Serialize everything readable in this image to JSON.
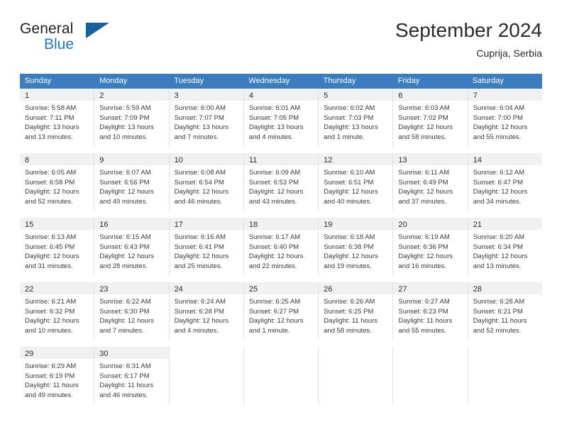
{
  "brand": {
    "name_top": "General",
    "name_bottom": "Blue",
    "flag_color": "#15619e",
    "blue_color": "#2077c4"
  },
  "header": {
    "title": "September 2024",
    "location": "Cuprija, Serbia"
  },
  "theme": {
    "header_blue": "#3b7dbf",
    "daynum_band": "#f1f1f1",
    "cell_border": "#e2e2e2"
  },
  "weekdays": [
    "Sunday",
    "Monday",
    "Tuesday",
    "Wednesday",
    "Thursday",
    "Friday",
    "Saturday"
  ],
  "weeks": [
    [
      {
        "day": "1",
        "sunrise": "Sunrise: 5:58 AM",
        "sunset": "Sunset: 7:11 PM",
        "daylight1": "Daylight: 13 hours",
        "daylight2": "and 13 minutes."
      },
      {
        "day": "2",
        "sunrise": "Sunrise: 5:59 AM",
        "sunset": "Sunset: 7:09 PM",
        "daylight1": "Daylight: 13 hours",
        "daylight2": "and 10 minutes."
      },
      {
        "day": "3",
        "sunrise": "Sunrise: 6:00 AM",
        "sunset": "Sunset: 7:07 PM",
        "daylight1": "Daylight: 13 hours",
        "daylight2": "and 7 minutes."
      },
      {
        "day": "4",
        "sunrise": "Sunrise: 6:01 AM",
        "sunset": "Sunset: 7:05 PM",
        "daylight1": "Daylight: 13 hours",
        "daylight2": "and 4 minutes."
      },
      {
        "day": "5",
        "sunrise": "Sunrise: 6:02 AM",
        "sunset": "Sunset: 7:03 PM",
        "daylight1": "Daylight: 13 hours",
        "daylight2": "and 1 minute."
      },
      {
        "day": "6",
        "sunrise": "Sunrise: 6:03 AM",
        "sunset": "Sunset: 7:02 PM",
        "daylight1": "Daylight: 12 hours",
        "daylight2": "and 58 minutes."
      },
      {
        "day": "7",
        "sunrise": "Sunrise: 6:04 AM",
        "sunset": "Sunset: 7:00 PM",
        "daylight1": "Daylight: 12 hours",
        "daylight2": "and 55 minutes."
      }
    ],
    [
      {
        "day": "8",
        "sunrise": "Sunrise: 6:05 AM",
        "sunset": "Sunset: 6:58 PM",
        "daylight1": "Daylight: 12 hours",
        "daylight2": "and 52 minutes."
      },
      {
        "day": "9",
        "sunrise": "Sunrise: 6:07 AM",
        "sunset": "Sunset: 6:56 PM",
        "daylight1": "Daylight: 12 hours",
        "daylight2": "and 49 minutes."
      },
      {
        "day": "10",
        "sunrise": "Sunrise: 6:08 AM",
        "sunset": "Sunset: 6:54 PM",
        "daylight1": "Daylight: 12 hours",
        "daylight2": "and 46 minutes."
      },
      {
        "day": "11",
        "sunrise": "Sunrise: 6:09 AM",
        "sunset": "Sunset: 6:53 PM",
        "daylight1": "Daylight: 12 hours",
        "daylight2": "and 43 minutes."
      },
      {
        "day": "12",
        "sunrise": "Sunrise: 6:10 AM",
        "sunset": "Sunset: 6:51 PM",
        "daylight1": "Daylight: 12 hours",
        "daylight2": "and 40 minutes."
      },
      {
        "day": "13",
        "sunrise": "Sunrise: 6:11 AM",
        "sunset": "Sunset: 6:49 PM",
        "daylight1": "Daylight: 12 hours",
        "daylight2": "and 37 minutes."
      },
      {
        "day": "14",
        "sunrise": "Sunrise: 6:12 AM",
        "sunset": "Sunset: 6:47 PM",
        "daylight1": "Daylight: 12 hours",
        "daylight2": "and 34 minutes."
      }
    ],
    [
      {
        "day": "15",
        "sunrise": "Sunrise: 6:13 AM",
        "sunset": "Sunset: 6:45 PM",
        "daylight1": "Daylight: 12 hours",
        "daylight2": "and 31 minutes."
      },
      {
        "day": "16",
        "sunrise": "Sunrise: 6:15 AM",
        "sunset": "Sunset: 6:43 PM",
        "daylight1": "Daylight: 12 hours",
        "daylight2": "and 28 minutes."
      },
      {
        "day": "17",
        "sunrise": "Sunrise: 6:16 AM",
        "sunset": "Sunset: 6:41 PM",
        "daylight1": "Daylight: 12 hours",
        "daylight2": "and 25 minutes."
      },
      {
        "day": "18",
        "sunrise": "Sunrise: 6:17 AM",
        "sunset": "Sunset: 6:40 PM",
        "daylight1": "Daylight: 12 hours",
        "daylight2": "and 22 minutes."
      },
      {
        "day": "19",
        "sunrise": "Sunrise: 6:18 AM",
        "sunset": "Sunset: 6:38 PM",
        "daylight1": "Daylight: 12 hours",
        "daylight2": "and 19 minutes."
      },
      {
        "day": "20",
        "sunrise": "Sunrise: 6:19 AM",
        "sunset": "Sunset: 6:36 PM",
        "daylight1": "Daylight: 12 hours",
        "daylight2": "and 16 minutes."
      },
      {
        "day": "21",
        "sunrise": "Sunrise: 6:20 AM",
        "sunset": "Sunset: 6:34 PM",
        "daylight1": "Daylight: 12 hours",
        "daylight2": "and 13 minutes."
      }
    ],
    [
      {
        "day": "22",
        "sunrise": "Sunrise: 6:21 AM",
        "sunset": "Sunset: 6:32 PM",
        "daylight1": "Daylight: 12 hours",
        "daylight2": "and 10 minutes."
      },
      {
        "day": "23",
        "sunrise": "Sunrise: 6:22 AM",
        "sunset": "Sunset: 6:30 PM",
        "daylight1": "Daylight: 12 hours",
        "daylight2": "and 7 minutes."
      },
      {
        "day": "24",
        "sunrise": "Sunrise: 6:24 AM",
        "sunset": "Sunset: 6:28 PM",
        "daylight1": "Daylight: 12 hours",
        "daylight2": "and 4 minutes."
      },
      {
        "day": "25",
        "sunrise": "Sunrise: 6:25 AM",
        "sunset": "Sunset: 6:27 PM",
        "daylight1": "Daylight: 12 hours",
        "daylight2": "and 1 minute."
      },
      {
        "day": "26",
        "sunrise": "Sunrise: 6:26 AM",
        "sunset": "Sunset: 6:25 PM",
        "daylight1": "Daylight: 11 hours",
        "daylight2": "and 58 minutes."
      },
      {
        "day": "27",
        "sunrise": "Sunrise: 6:27 AM",
        "sunset": "Sunset: 6:23 PM",
        "daylight1": "Daylight: 11 hours",
        "daylight2": "and 55 minutes."
      },
      {
        "day": "28",
        "sunrise": "Sunrise: 6:28 AM",
        "sunset": "Sunset: 6:21 PM",
        "daylight1": "Daylight: 11 hours",
        "daylight2": "and 52 minutes."
      }
    ],
    [
      {
        "day": "29",
        "sunrise": "Sunrise: 6:29 AM",
        "sunset": "Sunset: 6:19 PM",
        "daylight1": "Daylight: 11 hours",
        "daylight2": "and 49 minutes."
      },
      {
        "day": "30",
        "sunrise": "Sunrise: 6:31 AM",
        "sunset": "Sunset: 6:17 PM",
        "daylight1": "Daylight: 11 hours",
        "daylight2": "and 46 minutes."
      },
      {
        "day": "",
        "sunrise": "",
        "sunset": "",
        "daylight1": "",
        "daylight2": ""
      },
      {
        "day": "",
        "sunrise": "",
        "sunset": "",
        "daylight1": "",
        "daylight2": ""
      },
      {
        "day": "",
        "sunrise": "",
        "sunset": "",
        "daylight1": "",
        "daylight2": ""
      },
      {
        "day": "",
        "sunrise": "",
        "sunset": "",
        "daylight1": "",
        "daylight2": ""
      },
      {
        "day": "",
        "sunrise": "",
        "sunset": "",
        "daylight1": "",
        "daylight2": ""
      }
    ]
  ]
}
